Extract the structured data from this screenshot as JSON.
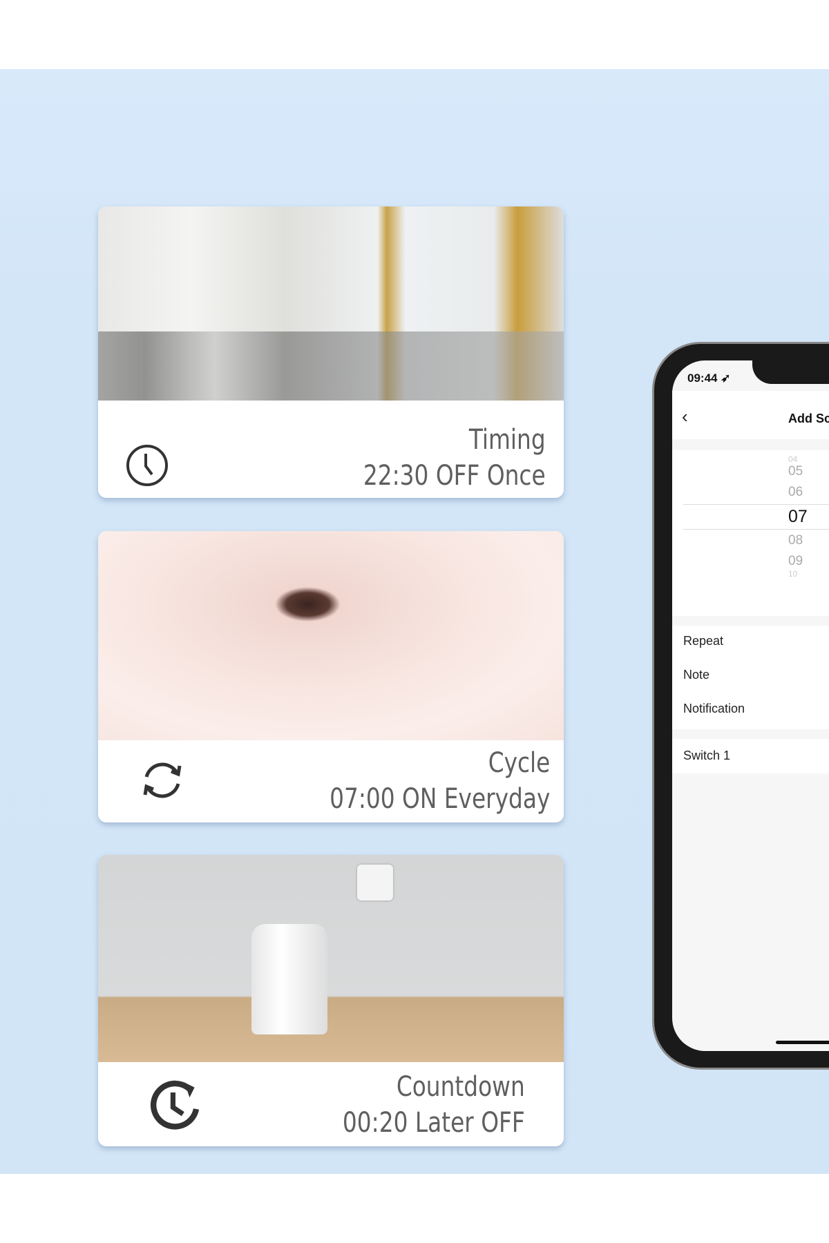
{
  "cards": [
    {
      "title": "Timing",
      "detail": "22:30 OFF Once",
      "icon": "clock-icon"
    },
    {
      "title": "Cycle",
      "detail": "07:00 ON Everyday",
      "icon": "refresh-icon"
    },
    {
      "title": "Countdown",
      "detail": "00:20 Later OFF",
      "icon": "countdown-clock-icon"
    }
  ],
  "phone": {
    "status_time": "09:44",
    "nav_title": "Add Sc",
    "picker": [
      "04",
      "05",
      "06",
      "07",
      "08",
      "09",
      "10"
    ],
    "selected": "07",
    "rows": [
      "Repeat",
      "Note",
      "Notification"
    ],
    "switch_row": "Switch 1"
  },
  "colors": {
    "background": "#d4e7f9",
    "text": "#5f5f5f"
  }
}
